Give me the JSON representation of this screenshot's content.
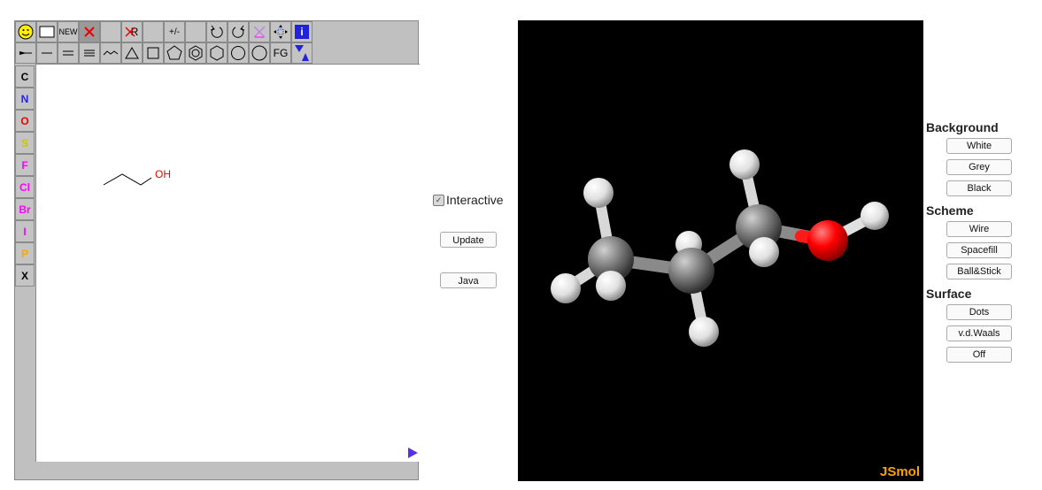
{
  "editor": {
    "toolbar_row1": [
      "smiley-icon",
      "clear-box-icon",
      "NEW",
      "delete-x-icon",
      "blank",
      "R",
      "blank",
      "+/-",
      "blank",
      "undo-icon",
      "redo-icon",
      "cross-icon",
      "move-icon",
      "i"
    ],
    "toolbar_row2": [
      "chain-bond-icon",
      "single-bond-icon",
      "double-bond-icon",
      "triple-bond-icon",
      "wave-icon",
      "triangle-icon",
      "square-icon",
      "pentagon-icon",
      "benzene-icon",
      "hexagon-icon",
      "heptagon-icon",
      "octagon-icon",
      "FG",
      "marker-icon"
    ],
    "labels": {
      "new": "NEW",
      "r_group": "R",
      "charge": "+/-",
      "fg": "FG",
      "info": "i"
    },
    "atoms": [
      {
        "label": "C",
        "color": "#000000"
      },
      {
        "label": "N",
        "color": "#2222ff"
      },
      {
        "label": "O",
        "color": "#ee0000"
      },
      {
        "label": "S",
        "color": "#c8c800"
      },
      {
        "label": "F",
        "color": "#ff00ff"
      },
      {
        "label": "Cl",
        "color": "#ff00ff"
      },
      {
        "label": "Br",
        "color": "#ff00ff"
      },
      {
        "label": "I",
        "color": "#ff00ff"
      },
      {
        "label": "P",
        "color": "#ffa500"
      },
      {
        "label": "X",
        "color": "#000000"
      }
    ],
    "molecule_label": "OH"
  },
  "controls": {
    "interactive_label": "Interactive",
    "interactive_checked": true,
    "update_label": "Update",
    "java_label": "Java"
  },
  "viewer": {
    "logo": "JSmol",
    "background": "#000000"
  },
  "panel": {
    "background_heading": "Background",
    "background_buttons": [
      "White",
      "Grey",
      "Black"
    ],
    "scheme_heading": "Scheme",
    "scheme_buttons": [
      "Wire",
      "Spacefill",
      "Ball&Stick"
    ],
    "surface_heading": "Surface",
    "surface_buttons": [
      "Dots",
      "v.d.Waals",
      "Off"
    ]
  }
}
